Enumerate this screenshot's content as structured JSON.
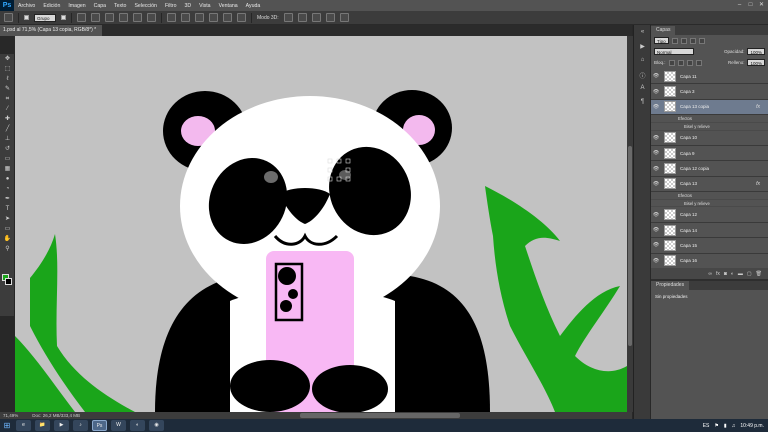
{
  "app": {
    "logo": "Ps"
  },
  "menu": [
    "Archivo",
    "Edición",
    "Imagen",
    "Capa",
    "Texto",
    "Selección",
    "Filtro",
    "3D",
    "Vista",
    "Ventana",
    "Ayuda"
  ],
  "window_buttons": [
    "–",
    "□",
    "✕"
  ],
  "options_bar": {
    "auto_select_label": "Grupo",
    "mode_3d_label": "Modo 3D:"
  },
  "document": {
    "tab_title": "1.psd al 71,5% (Capa 13 copia, RGB/8*) *"
  },
  "toolbar_icons": [
    "move-icon",
    "marquee-icon",
    "lasso-icon",
    "quick-select-icon",
    "crop-icon",
    "eyedropper-icon",
    "healing-icon",
    "brush-icon",
    "stamp-icon",
    "history-brush-icon",
    "eraser-icon",
    "gradient-icon",
    "blur-icon",
    "dodge-icon",
    "pen-icon",
    "type-icon",
    "path-select-icon",
    "shape-icon",
    "hand-icon",
    "zoom-icon"
  ],
  "colors": {
    "foreground": "#1aa51a",
    "background": "#000000",
    "canvas_bg": "#c2c2c2",
    "selected_layer": "#6e7b8f"
  },
  "status": {
    "zoom": "71,49%",
    "doc": "Doc: 26,2 MB/333,4 MB"
  },
  "panels": {
    "layers_tabs": [
      "Capas"
    ],
    "filter_label": "Tipo",
    "blend_mode": "Normal",
    "opacity_label": "Opacidad:",
    "opacity_value": "100%",
    "lock_label": "Bloq.:",
    "fill_label": "Relleno:",
    "fill_value": "100%"
  },
  "layers": [
    {
      "name": "Capa 11",
      "selected": false,
      "fx": false
    },
    {
      "name": "Capa 3",
      "selected": false,
      "fx": false
    },
    {
      "name": "Capa 13 copia",
      "selected": true,
      "fx": true,
      "effects_label": "Efectos",
      "effect": "Bisel y relieve"
    },
    {
      "name": "Capa 10",
      "selected": false,
      "fx": false
    },
    {
      "name": "Capa 9",
      "selected": false,
      "fx": false
    },
    {
      "name": "Capa 12 copia",
      "selected": false,
      "fx": false
    },
    {
      "name": "Capa 13",
      "selected": false,
      "fx": true,
      "effects_label": "Efectos",
      "effect": "Bisel y relieve"
    },
    {
      "name": "Capa 12",
      "selected": false,
      "fx": false
    },
    {
      "name": "Capa 14",
      "selected": false,
      "fx": false
    },
    {
      "name": "Capa 15",
      "selected": false,
      "fx": false
    },
    {
      "name": "Capa 16",
      "selected": false,
      "fx": false
    }
  ],
  "properties": {
    "tab": "Propiedades",
    "body": "Sin propiedades"
  },
  "taskbar": {
    "apps": [
      "e",
      "📁",
      "▶",
      "♪",
      "Ps",
      "W",
      "◐",
      "◉"
    ],
    "lang": "ES",
    "time": "10:49 p.m."
  }
}
